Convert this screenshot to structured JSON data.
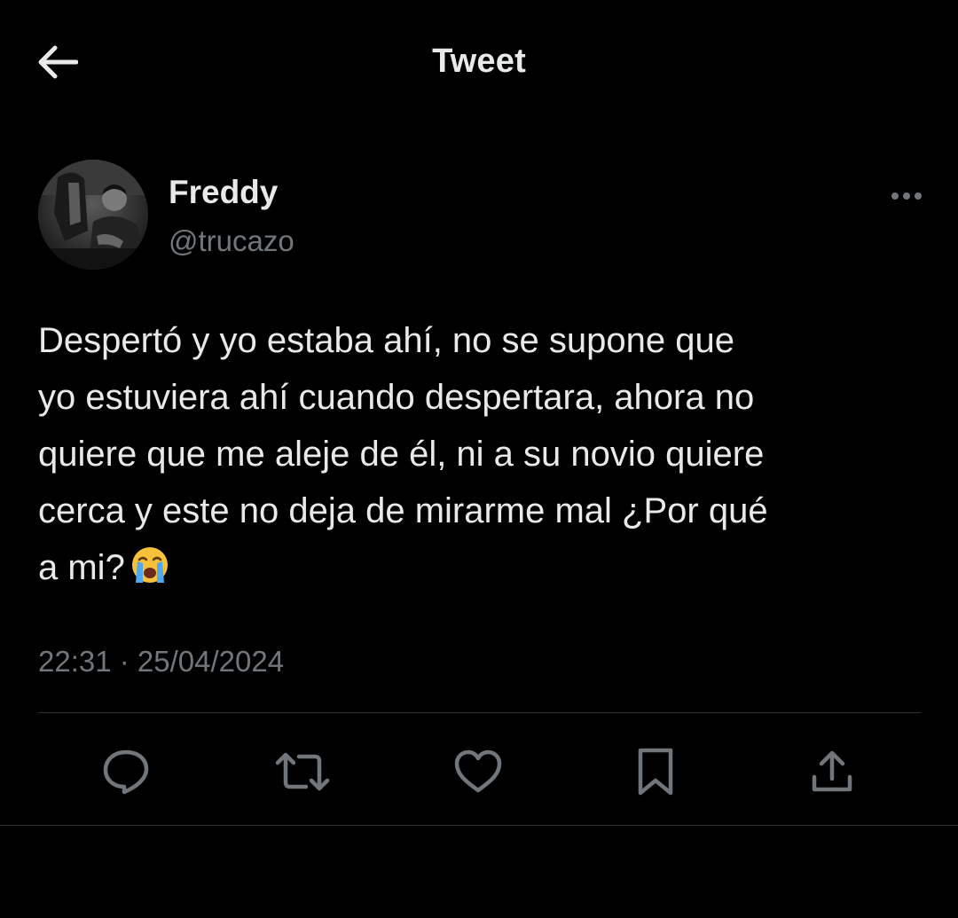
{
  "header": {
    "title": "Tweet",
    "back_icon": "back-arrow-icon"
  },
  "tweet": {
    "author": {
      "name": "Freddy",
      "handle": "@trucazo"
    },
    "text": "Despertó y yo estaba ahí, no se supone que\nyo estuviera ahí cuando despertara, ahora no\nquiere que me aleje de él, ni a su novio quiere\ncerca y este no deja de mirarme mal ¿Por qué\na mi?",
    "emoji": "loudly-crying-face",
    "timestamp": "22:31 · 25/04/2024"
  },
  "actions": [
    {
      "icon": "reply-icon"
    },
    {
      "icon": "retweet-icon"
    },
    {
      "icon": "like-icon"
    },
    {
      "icon": "bookmark-icon"
    },
    {
      "icon": "share-icon"
    }
  ],
  "colors": {
    "background": "#000000",
    "text_primary": "#e7e9ea",
    "text_secondary": "#71767b",
    "divider": "#2f3336"
  }
}
